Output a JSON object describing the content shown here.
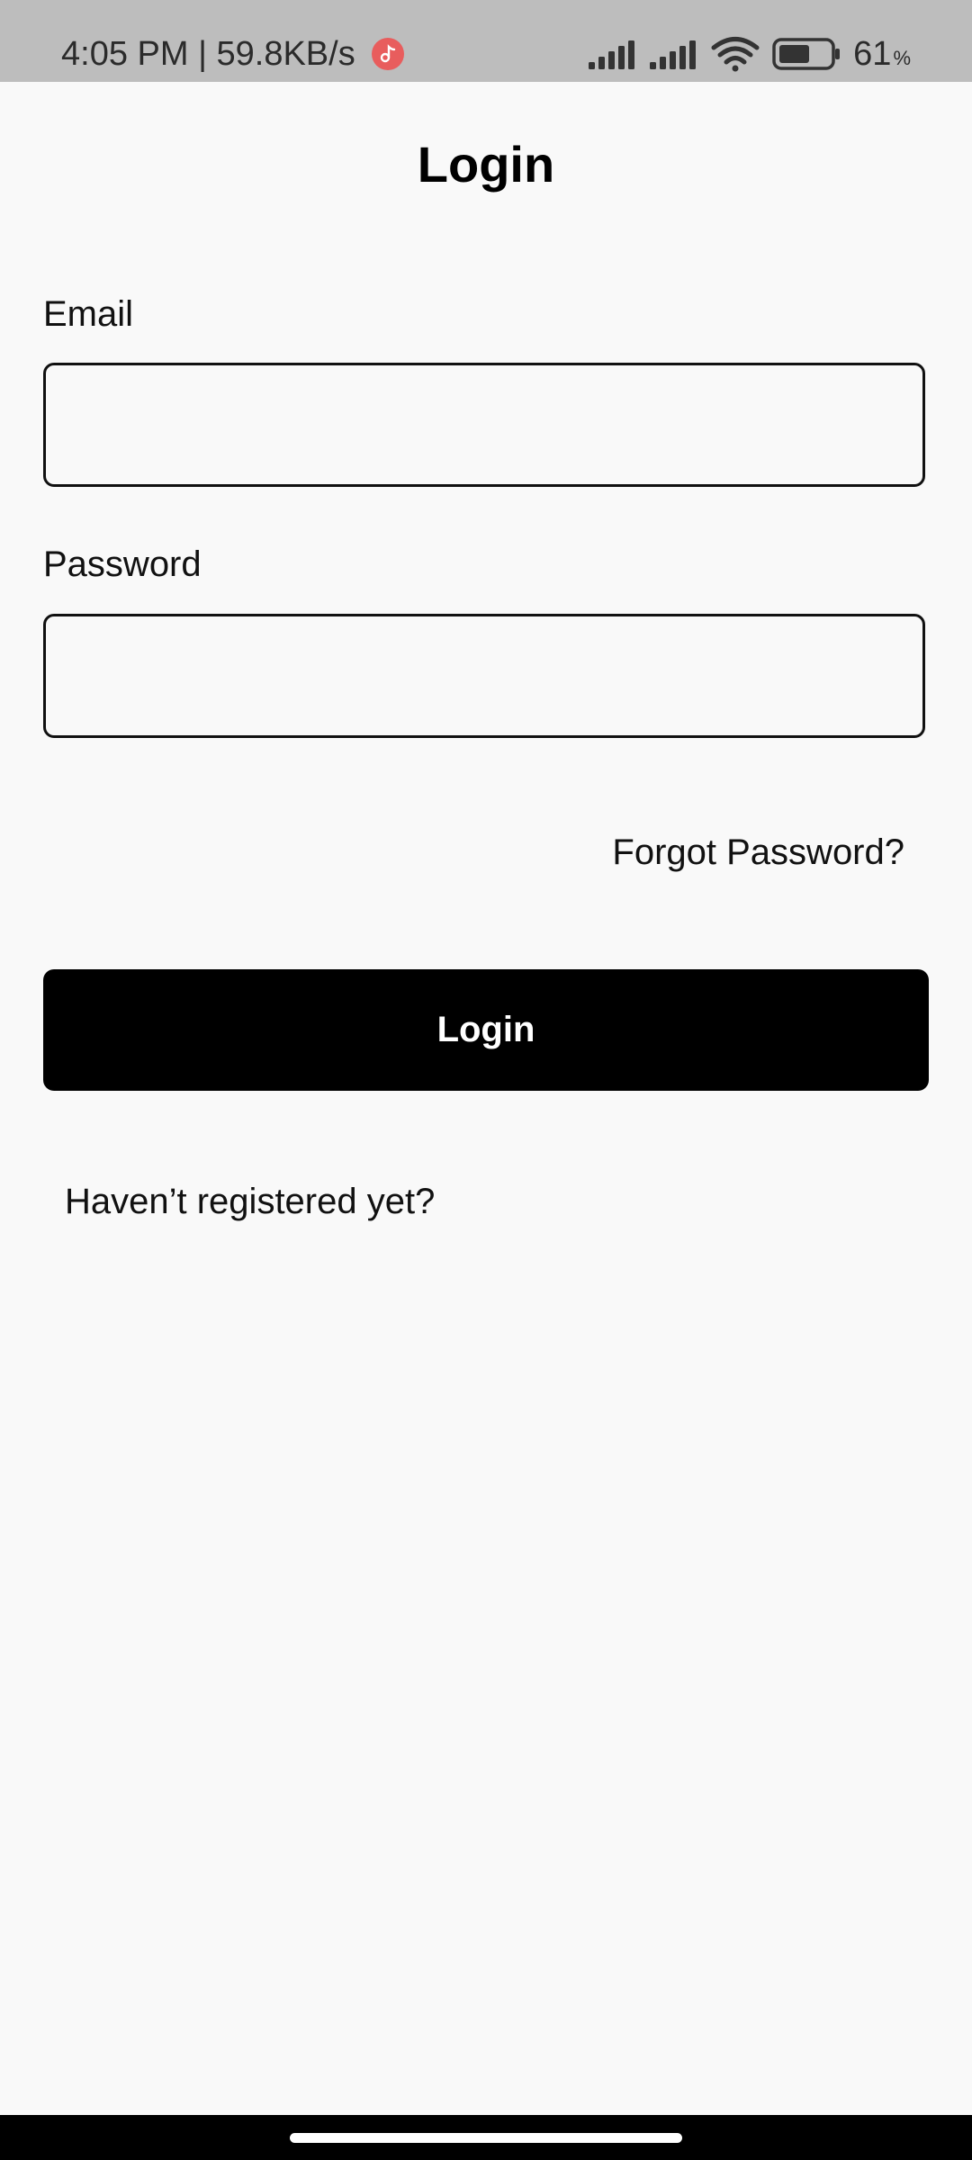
{
  "status_bar": {
    "time_speed": "4:05 PM | 59.8KB/s",
    "battery_level": "61",
    "battery_unit": "%",
    "icons": [
      "music-app-icon",
      "signal-icon",
      "signal-icon",
      "wifi-icon",
      "battery-icon"
    ],
    "battery_fill_fraction": 0.61
  },
  "page": {
    "title": "Login"
  },
  "form": {
    "email_label": "Email",
    "email_value": "",
    "password_label": "Password",
    "password_value": "",
    "forgot_password": "Forgot Password?",
    "login_button": "Login",
    "register_prompt": "Haven’t registered yet?"
  },
  "colors": {
    "status_bar_bg": "#bdbdbd",
    "page_bg": "#f9f9f9",
    "button_bg": "#000000",
    "music_badge": "#e85d5d"
  }
}
